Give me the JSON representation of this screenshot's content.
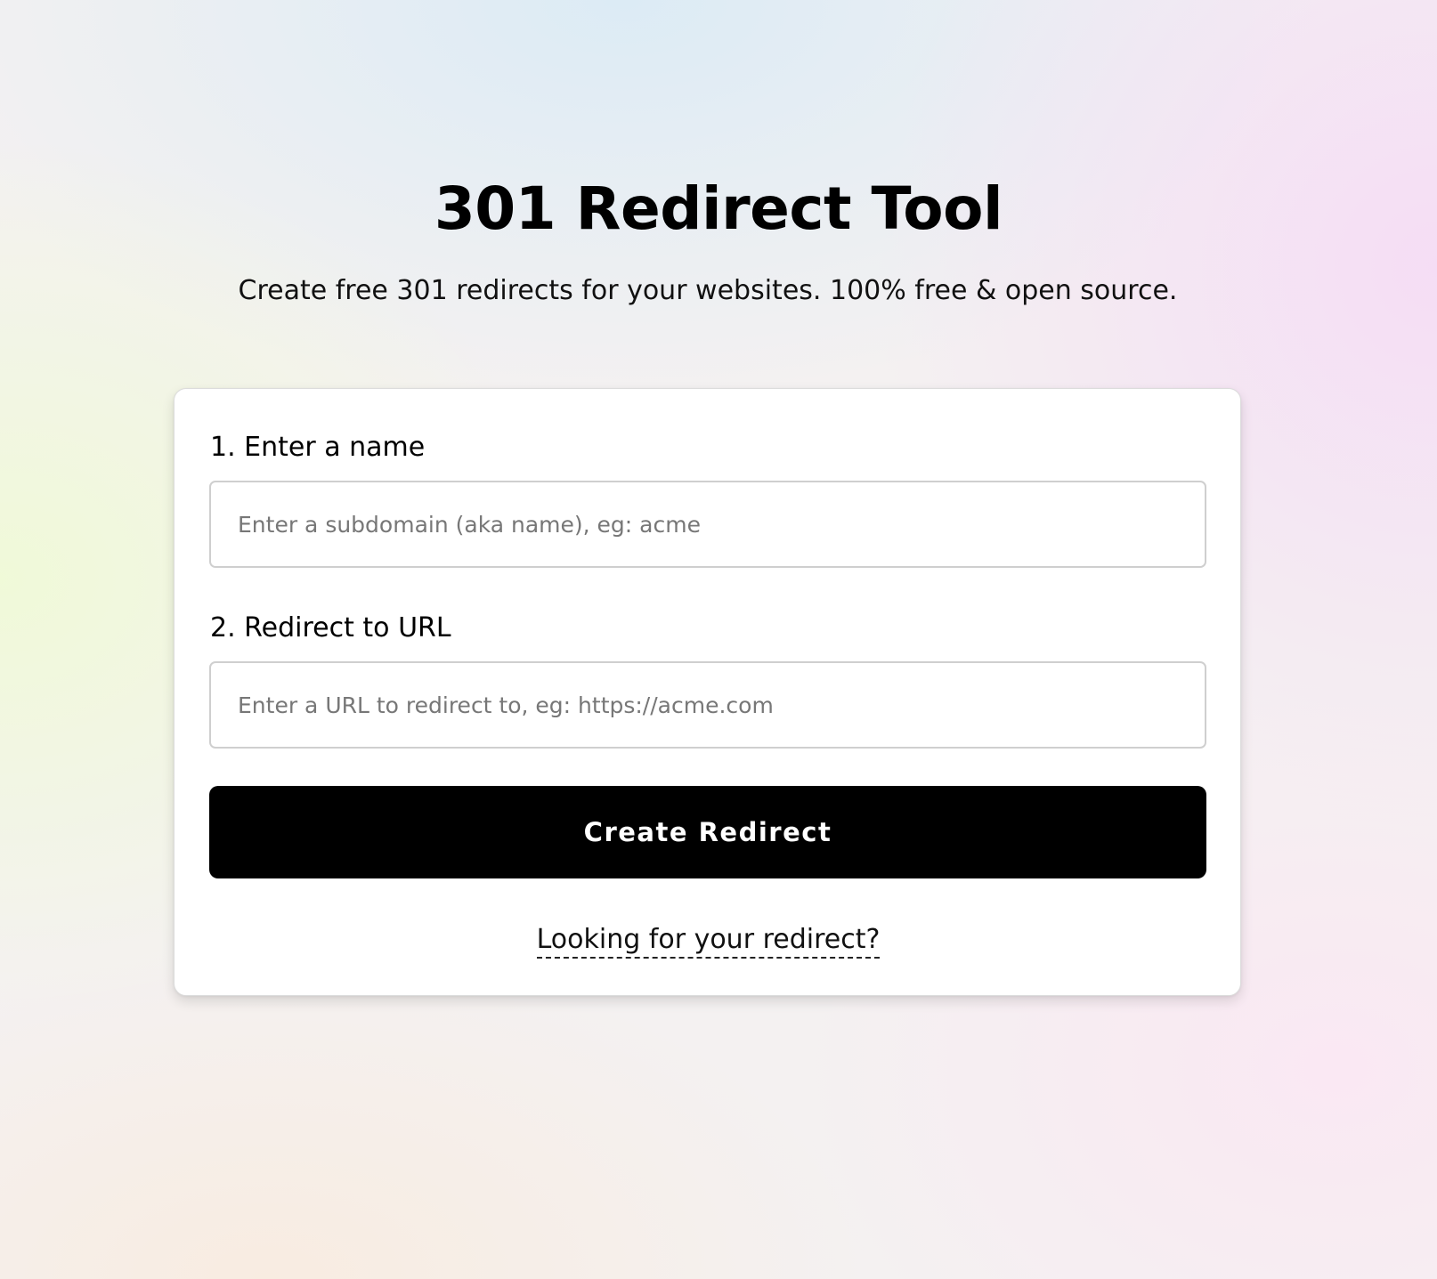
{
  "header": {
    "title": "301 Redirect Tool",
    "subtitle": "Create free 301 redirects for your websites. 100% free & open source."
  },
  "form": {
    "name_label": "1. Enter a name",
    "name_value": "",
    "name_placeholder": "Enter a subdomain (aka name), eg: acme",
    "url_label": "2. Redirect to URL",
    "url_value": "",
    "url_placeholder": "Enter a URL to redirect to, eg: https://acme.com",
    "submit_label": "Create Redirect",
    "lookup_link_label": "Looking for your redirect?"
  },
  "colors": {
    "button_background": "#000000",
    "button_text": "#ffffff",
    "card_background": "#ffffff"
  }
}
